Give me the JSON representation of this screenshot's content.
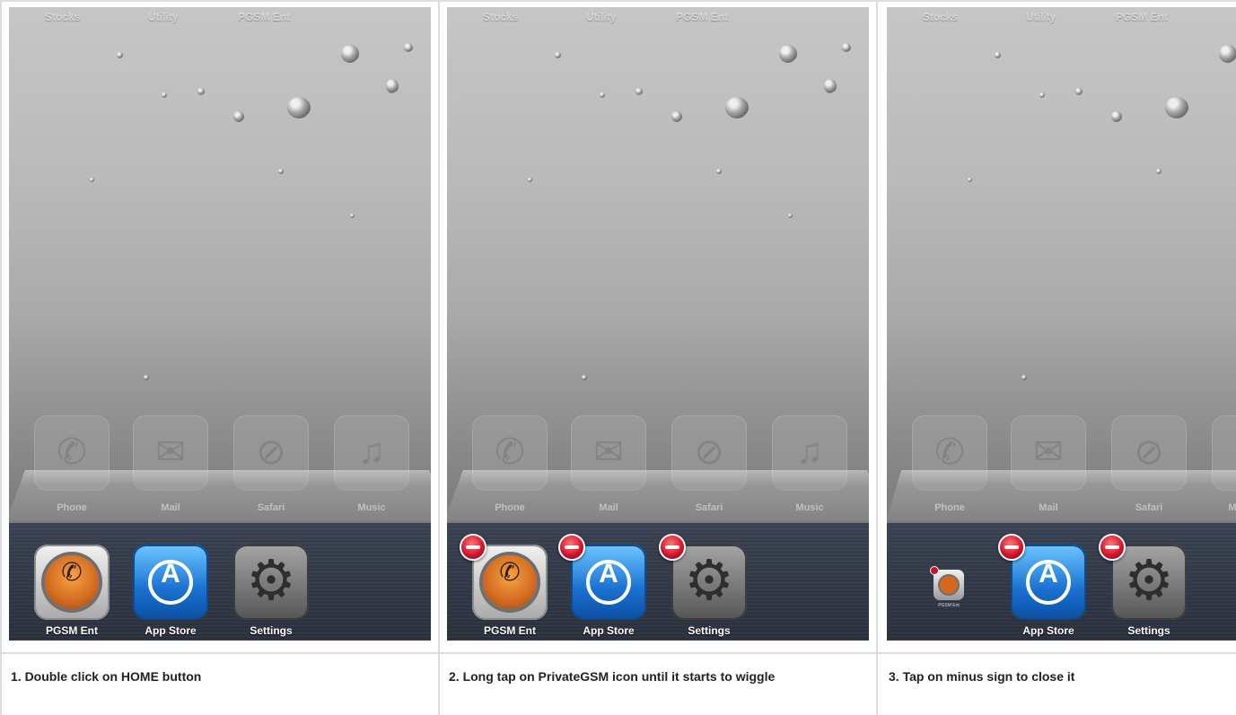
{
  "panels": [
    {
      "step": "1. Double click on HOME button",
      "top_labels": [
        "Stocks",
        "Utility",
        "PGSM Ent"
      ],
      "dock": [
        "Phone",
        "Mail",
        "Safari",
        "Music"
      ],
      "apps": [
        "PGSM Ent",
        "App Store",
        "Settings"
      ]
    },
    {
      "step": "2. Long tap on PrivateGSM icon until it starts to wiggle",
      "top_labels": [
        "Stocks",
        "Utility",
        "PGSM Ent"
      ],
      "dock": [
        "Phone",
        "Mail",
        "Safari",
        "Music"
      ],
      "apps": [
        "PGSM Ent",
        "App Store",
        "Settings"
      ]
    },
    {
      "step": "3. Tap on minus sign to close it",
      "top_labels": [
        "Stocks",
        "Utility",
        "PGSM Ent"
      ],
      "dock": [
        "Phone",
        "Mail",
        "Safari",
        "M"
      ],
      "apps": [
        "PGSM Ent",
        "App Store",
        "Settings"
      ]
    }
  ],
  "icons": {
    "phone": "phone-icon",
    "mail": "mail-icon",
    "safari": "safari-icon",
    "music": "music-icon",
    "pgsm": "pgsm-ent-icon",
    "app_store": "app-store-icon",
    "settings": "settings-gear-icon",
    "close": "minus-sign-icon"
  },
  "colors": {
    "minus_red": "#d0102a",
    "tray": "#2e3440",
    "grid_line": "#d9dde2"
  }
}
